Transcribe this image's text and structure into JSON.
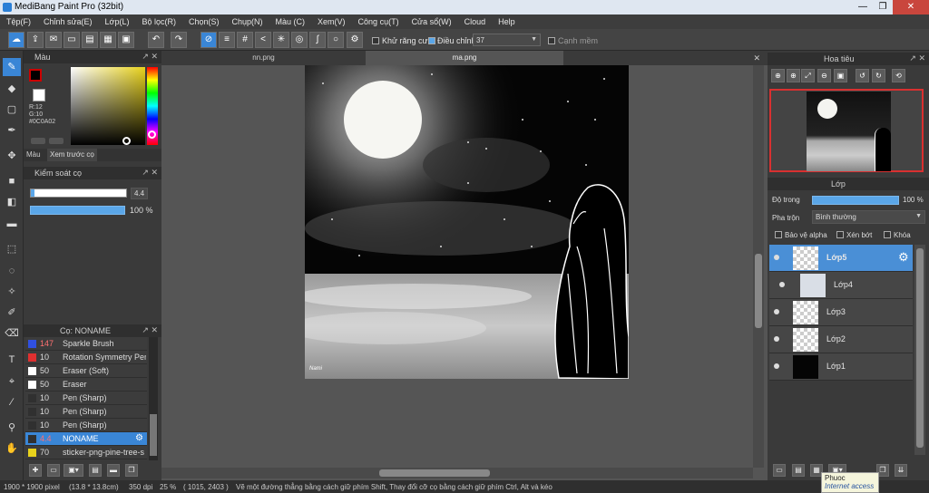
{
  "window": {
    "title": "MediBang Paint Pro (32bit)",
    "minimize": "—",
    "maximize": "❐",
    "close": "✕"
  },
  "menu": [
    "Tệp(F)",
    "Chỉnh sửa(E)",
    "Lớp(L)",
    "Bộ lọc(R)",
    "Chọn(S)",
    "Chụp(N)",
    "Màu (C)",
    "Xem(V)",
    "Công cụ(T)",
    "Cửa sổ(W)",
    "Cloud",
    "Help"
  ],
  "toolbar": {
    "antialias_label": "Khử răng cưa",
    "correction_label": "Điều chỉnh",
    "correction_value": "37",
    "edge_label": "Cạnh mềm"
  },
  "color_panel": {
    "title": "Màu",
    "r": "R:12",
    "g": "G:10",
    "hex": "#0C0A02",
    "tab_color": "Màu",
    "tab_preview": "Xem trước cọ",
    "primary_color": "#0C0A02"
  },
  "brush_control": {
    "title": "Kiểm soát cọ",
    "size_value": "4.4",
    "opacity_value": "100 %",
    "opacity_fraction": 1.0
  },
  "brush_list": {
    "title": "Cọ: NONAME",
    "items": [
      {
        "color": "#3050e0",
        "size": "147",
        "name": "Sparkle Brush"
      },
      {
        "color": "#e03030",
        "size": "10",
        "name": "Rotation Symmetry Pen"
      },
      {
        "color": "#ffffff",
        "size": "50",
        "name": "Eraser (Soft)"
      },
      {
        "color": "#ffffff",
        "size": "50",
        "name": "Eraser"
      },
      {
        "color": "#303030",
        "size": "10",
        "name": "Pen (Sharp)"
      },
      {
        "color": "#303030",
        "size": "10",
        "name": "Pen (Sharp)"
      },
      {
        "color": "#303030",
        "size": "10",
        "name": "Pen (Sharp)"
      },
      {
        "color": "#303030",
        "size": "4.4",
        "name": "NONAME"
      },
      {
        "color": "#e8d21c",
        "size": "70",
        "name": "sticker-png-pine-tree-s"
      }
    ]
  },
  "canvas": {
    "tabs": [
      "nn.png",
      "ma.png"
    ],
    "signature": "Nami"
  },
  "navigator": {
    "title": "Hoa tiêu"
  },
  "layers": {
    "title": "Lớp",
    "opacity_label": "Độ trong",
    "opacity_value": "100 %",
    "blend_label": "Pha trộn",
    "blend_value": "Bình thường",
    "protect_alpha": "Bảo vệ alpha",
    "clipping": "Xén bớt",
    "lock": "Khóa",
    "items": [
      "Lớp5",
      "Lớp4",
      "Lớp3",
      "Lớp2",
      "Lớp1"
    ]
  },
  "status": {
    "size": "1900 * 1900 pixel",
    "physical": "(13.8 * 13.8cm)",
    "dpi": "350 dpi",
    "zoom": "25 %",
    "coords": "( 1015, 2403 )",
    "hint": "Vẽ một đường thẳng bằng cách giữ phím Shift, Thay đổi cỡ cọ bằng cách giữ phím Ctrl, Alt và kéo"
  },
  "tooltip": {
    "name": "Phuoc",
    "status": "Internet access"
  }
}
